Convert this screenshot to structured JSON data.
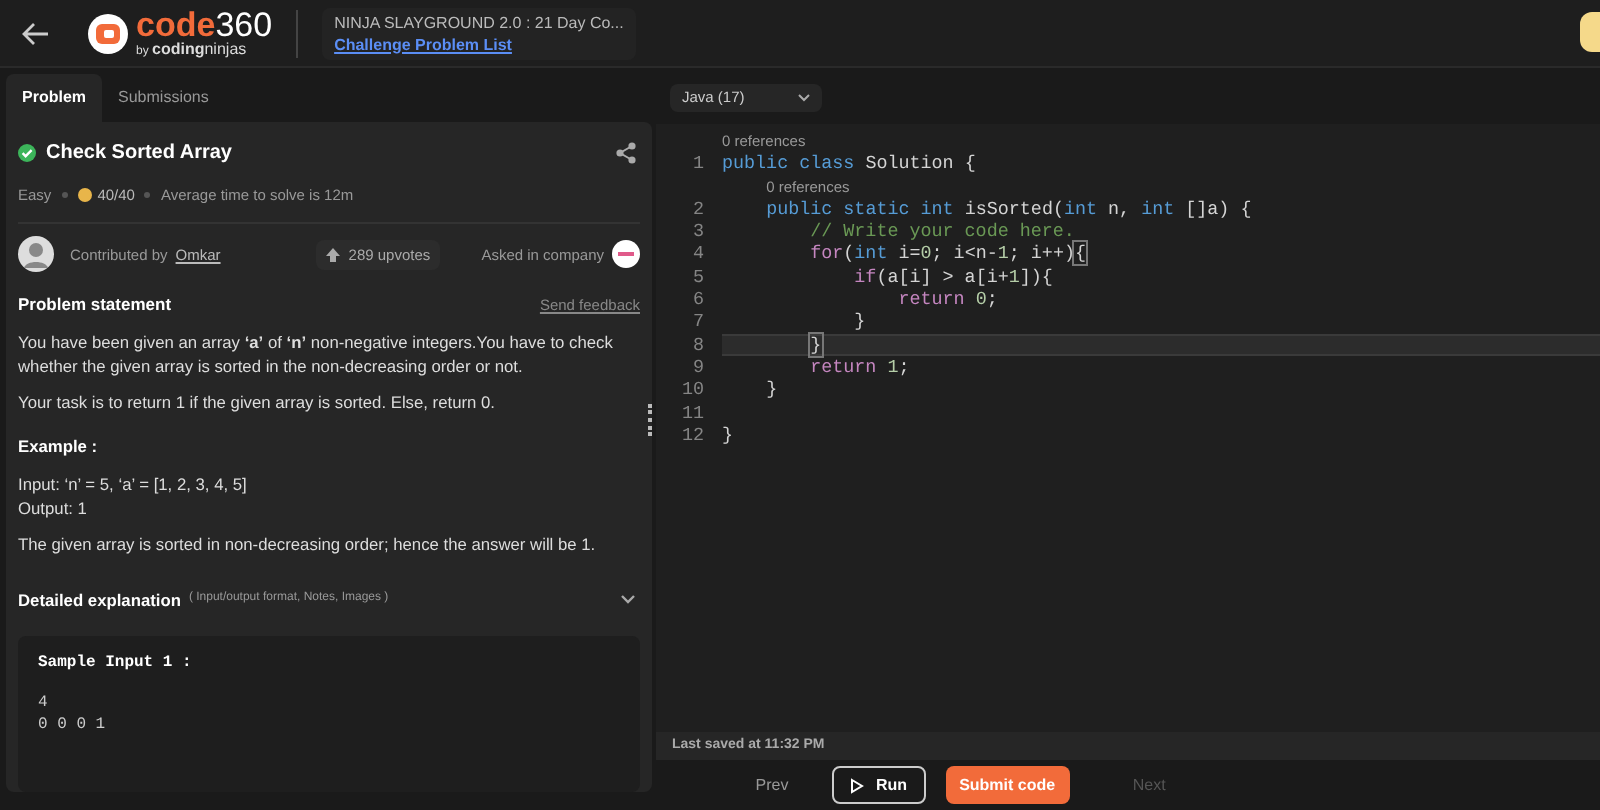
{
  "header": {
    "logo": {
      "brand_a": "code",
      "brand_b": "360",
      "byline_a": "by",
      "byline_b": "coding",
      "byline_c": "ninjas"
    },
    "contest_title": "NINJA SLAYGROUND 2.0 : 21 Day Co...",
    "contest_link": "Challenge Problem List"
  },
  "tabs": [
    {
      "label": "Problem",
      "selected": true
    },
    {
      "label": "Submissions",
      "selected": false
    }
  ],
  "problem": {
    "title": "Check Sorted Array",
    "solved": true,
    "difficulty": "Easy",
    "score": "40/40",
    "avg_time": "Average time to solve is 12m",
    "contributed_label": "Contributed by",
    "contributor": "Omkar",
    "upvotes": "289 upvotes",
    "asked_label": "Asked in company",
    "statement_heading": "Problem statement",
    "feedback_link": "Send feedback",
    "paragraphs": [
      {
        "kind": "text",
        "text": "You have been given an array **‘a’** of **‘n’** non-negative integers.You have to check whether the given array is sorted in the non-decreasing order or not."
      },
      {
        "kind": "text",
        "text": "Your task is to return 1 if the given array is sorted. Else, return 0."
      },
      {
        "kind": "heading",
        "text": "Example :"
      },
      {
        "kind": "lines",
        "lines": [
          "Input: ‘n’ = 5, ‘a’ = [1, 2, 3, 4, 5]",
          "Output: 1"
        ]
      },
      {
        "kind": "text",
        "text": "The given array is sorted in non-decreasing order; hence the answer will be 1."
      }
    ],
    "detail_heading": "Detailed explanation",
    "detail_hint": "( Input/output format, Notes, Images )",
    "detail_expanded": false,
    "sample": {
      "heading": "Sample Input 1 :",
      "lines": [
        "4",
        "0 0 0 1"
      ]
    }
  },
  "editor": {
    "language": "Java (17)",
    "lines": [
      {
        "number": "1",
        "lens": "0 references",
        "current": false,
        "tokens": [
          {
            "kind": "kw",
            "t": "public"
          },
          {
            "kind": "kw",
            "t": " class"
          },
          {
            "kind": "plain",
            "t": " Solution {"
          }
        ]
      },
      {
        "number": "2",
        "lens": "0 references",
        "current": false,
        "tokens": [
          {
            "kind": "kw",
            "t": "    public"
          },
          {
            "kind": "kw",
            "t": " static"
          },
          {
            "kind": "kw",
            "t": " int"
          },
          {
            "kind": "plain",
            "t": " isSorted("
          },
          {
            "kind": "kw",
            "t": "int"
          },
          {
            "kind": "plain",
            "t": " n, "
          },
          {
            "kind": "kw",
            "t": "int"
          },
          {
            "kind": "plain",
            "t": " []a) {"
          }
        ]
      },
      {
        "number": "3",
        "current": false,
        "tokens": [
          {
            "kind": "comment",
            "t": "        // Write your code here."
          }
        ]
      },
      {
        "number": "4",
        "current": false,
        "tokens": [
          {
            "kind": "ctrl",
            "t": "        for"
          },
          {
            "kind": "plain",
            "t": "("
          },
          {
            "kind": "kw",
            "t": "int"
          },
          {
            "kind": "plain",
            "t": " i="
          },
          {
            "kind": "num",
            "t": "0"
          },
          {
            "kind": "plain",
            "t": "; i<n-"
          },
          {
            "kind": "num",
            "t": "1"
          },
          {
            "kind": "plain",
            "t": "; i++)"
          },
          {
            "kind": "match",
            "t": "{"
          }
        ]
      },
      {
        "number": "5",
        "current": false,
        "tokens": [
          {
            "kind": "ctrl",
            "t": "            if"
          },
          {
            "kind": "plain",
            "t": "(a[i] > a[i+"
          },
          {
            "kind": "num",
            "t": "1"
          },
          {
            "kind": "plain",
            "t": "]){"
          }
        ]
      },
      {
        "number": "6",
        "current": false,
        "tokens": [
          {
            "kind": "ctrl",
            "t": "                return"
          },
          {
            "kind": "num",
            "t": " 0"
          },
          {
            "kind": "plain",
            "t": ";"
          }
        ]
      },
      {
        "number": "7",
        "current": false,
        "tokens": [
          {
            "kind": "plain",
            "t": "            }"
          }
        ]
      },
      {
        "number": "8",
        "current": true,
        "tokens": [
          {
            "kind": "match",
            "t": "        }"
          }
        ]
      },
      {
        "number": "9",
        "current": false,
        "tokens": [
          {
            "kind": "ctrl",
            "t": "        return"
          },
          {
            "kind": "num",
            "t": " 1"
          },
          {
            "kind": "plain",
            "t": ";"
          }
        ]
      },
      {
        "number": "10",
        "current": false,
        "tokens": [
          {
            "kind": "plain",
            "t": "    }"
          }
        ]
      },
      {
        "number": "11",
        "current": false
      },
      {
        "number": "12",
        "current": false,
        "tokens": [
          {
            "kind": "plain",
            "t": "}"
          }
        ]
      }
    ],
    "saved": "Last saved at 11:32 PM"
  },
  "footer": {
    "prev": "Prev",
    "run": "Run",
    "submit": "Submit code",
    "next": "Next",
    "prev_disabled": false,
    "next_disabled": true
  }
}
